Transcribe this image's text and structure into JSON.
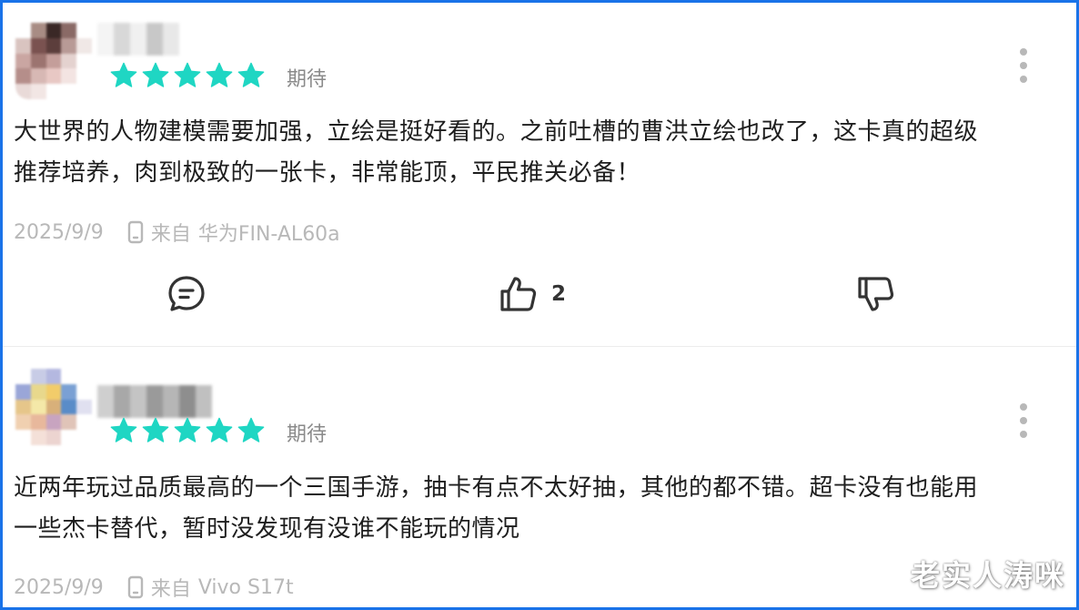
{
  "reviews": [
    {
      "rating": 5,
      "tag": "期待",
      "content_line1": "大世界的人物建模需要加强，立绘是挺好看的。之前吐槽的曹洪立绘也改了，这卡真的超级",
      "content_line2": "推荐培养，肉到极致的一张卡，非常能顶，平民推关必备！",
      "date": "2025/9/9",
      "from_label": "来自",
      "device": "华为FIN-AL60a",
      "like_count": "2",
      "icons": {
        "comment": "comment-icon",
        "like": "thumbs-up-icon",
        "dislike": "thumbs-down-icon",
        "device": "phone-icon",
        "more": "more-vertical-icon"
      }
    },
    {
      "rating": 5,
      "tag": "期待",
      "content_line1": "近两年玩过品质最高的一个三国手游，抽卡有点不太好抽，其他的都不错。超卡没有也能用",
      "content_line2": "一些杰卡替代，暂时没发现有没谁不能玩的情况",
      "date": "2025/9/9",
      "from_label": "来自",
      "device": "Vivo S17t"
    }
  ],
  "colors": {
    "star": "#1fd6c3",
    "border": "#1a73e8",
    "muted": "#b8b8b8"
  },
  "watermark": "老实人涛咪"
}
